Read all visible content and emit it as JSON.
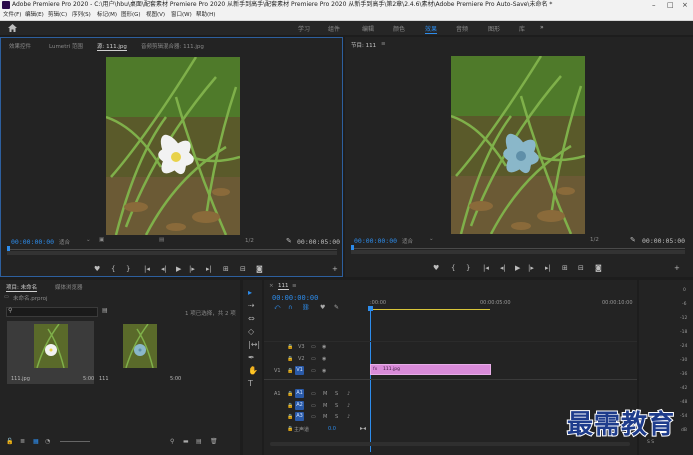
{
  "window": {
    "title": "Adobe Premiere Pro 2020 - C:\\用户\\hbu\\桌面\\配套素材 Premiere Pro 2020 从新手到高手\\配套素材 Premiere Pro 2020 从新手到高手\\第2章\\2.4.6\\素材\\Adobe Premiere Pro Auto-Save\\未命名 *"
  },
  "menu": [
    "文件(F)",
    "编辑(E)",
    "剪辑(C)",
    "序列(S)",
    "标记(M)",
    "图形(G)",
    "视图(V)",
    "窗口(W)",
    "帮助(H)"
  ],
  "workspaces": [
    "学习",
    "组件",
    "编辑",
    "颜色",
    "效果",
    "音频",
    "图形",
    "库"
  ],
  "workspace_active": "效果",
  "workspace_more": "»",
  "source": {
    "tabs": [
      "效果控件",
      "Lumetri 范围",
      "源: 111.jpg",
      "音频剪辑混合器: 111.jpg"
    ],
    "timecode_left": "00:00:00:00",
    "fit": "适合",
    "scale": "1/2",
    "timecode_right": "00:00:05:00"
  },
  "program": {
    "title": "节目: 111",
    "menu": "≡",
    "timecode_left": "00:00:00:00",
    "fit": "适合",
    "scale": "1/2",
    "timecode_right": "00:00:05:00"
  },
  "project": {
    "tabs": [
      "项目: 未命名",
      "媒体浏览器"
    ],
    "file": "未命名.prproj",
    "selection_info": "1 项已选择，共 2 项",
    "items": [
      {
        "name": "111.jpg",
        "duration": "5:00"
      },
      {
        "name": "111",
        "duration": "5:00"
      }
    ]
  },
  "timeline": {
    "tab": "111",
    "menu": "≡",
    "timecode": "00:00:00:00",
    "ruler": [
      ":00:00",
      "00:00:05:00",
      "00:00:10:00"
    ],
    "tracks": [
      {
        "label": "V3"
      },
      {
        "label": "V2"
      },
      {
        "label": "V1",
        "source": "V1"
      },
      {
        "label": "A1",
        "source": "A1"
      },
      {
        "label": "A2"
      },
      {
        "label": "A3"
      }
    ],
    "master": {
      "label": "主声道",
      "value": "0.0"
    },
    "clip": {
      "name": "111.jpg",
      "prefix": "fx",
      "color": "#d98bd9"
    }
  },
  "audio_meter": {
    "labels": [
      "0",
      "-6",
      "-12",
      "-18",
      "-24",
      "-30",
      "-36",
      "-42",
      "-48",
      "-54",
      "dB"
    ],
    "ss": "S S"
  },
  "watermark": "最需教育",
  "icons": {
    "home": "home-icon",
    "wrench": "wrench-icon",
    "play": "play-icon",
    "selection": "selection-tool-icon"
  }
}
